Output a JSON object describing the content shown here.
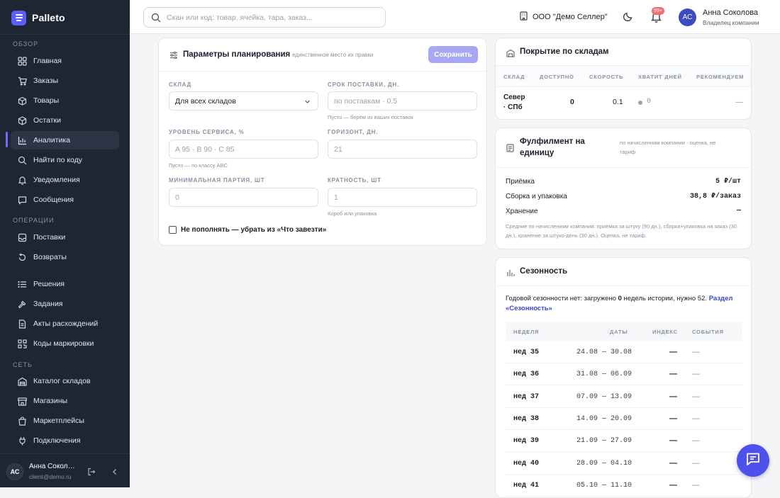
{
  "app": {
    "name": "Palleto"
  },
  "sidebar": {
    "sections": [
      {
        "label": "ОБЗОР"
      },
      {
        "label": "ОПЕРАЦИИ"
      },
      {
        "label": "СЕТЬ"
      }
    ],
    "items": [
      {
        "label": "Главная",
        "icon": "grid-icon"
      },
      {
        "label": "Заказы",
        "icon": "cart-icon"
      },
      {
        "label": "Товары",
        "icon": "box-icon"
      },
      {
        "label": "Остатки",
        "icon": "cube-icon"
      },
      {
        "label": "Аналитика",
        "icon": "chart-icon"
      },
      {
        "label": "Найти по коду",
        "icon": "search-icon"
      },
      {
        "label": "Уведомления",
        "icon": "bell-icon"
      },
      {
        "label": "Сообщения",
        "icon": "message-icon"
      },
      {
        "label": "Поставки",
        "icon": "inbox-icon"
      },
      {
        "label": "Возвраты",
        "icon": "return-icon"
      },
      {
        "label": "Решения",
        "icon": "list-icon"
      },
      {
        "label": "Задания",
        "icon": "hammer-icon"
      },
      {
        "label": "Акты расхождений",
        "icon": "document-icon"
      },
      {
        "label": "Коды маркировки",
        "icon": "qr-icon"
      },
      {
        "label": "Каталог складов",
        "icon": "warehouse-icon"
      },
      {
        "label": "Магазины",
        "icon": "store-icon"
      },
      {
        "label": "Маркетплейсы",
        "icon": "bag-icon"
      },
      {
        "label": "Подключения",
        "icon": "plug-icon"
      }
    ],
    "active_item": "Аналитика",
    "user": {
      "initials": "АС",
      "name": "Анна Соколова",
      "email": "client@demo.ru"
    }
  },
  "topbar": {
    "search_placeholder": "Скан или код: товар, ячейка, тара, заказ...",
    "org_name": "ООО \"Демо Селлер\"",
    "notifications_badge": "99+",
    "user_initials": "АС",
    "user_name": "Анна Соколова",
    "user_role": "Владелец компании"
  },
  "planning": {
    "title": "Параметры планирования",
    "subtitle": "единственное место их правки",
    "save_label": "Сохранить",
    "fields": {
      "warehouse": {
        "label": "СКЛАД",
        "value": "Для всех складов"
      },
      "lead_time": {
        "label": "СРОК ПОСТАВКИ, ДН.",
        "placeholder": "по поставкам · 0.5",
        "hint": "Пусто — берём из ваших поставок"
      },
      "service_level": {
        "label": "УРОВЕНЬ СЕРВИСА, %",
        "placeholder": "A 95 · B 90 · C 85",
        "hint": "Пусто — по классу ABC"
      },
      "horizon": {
        "label": "ГОРИЗОНТ, ДН.",
        "placeholder": "21"
      },
      "min_batch": {
        "label": "МИНИМАЛЬНАЯ ПАРТИЯ, ШТ",
        "placeholder": "0"
      },
      "multiplicity": {
        "label": "КРАТНОСТЬ, ШТ",
        "placeholder": "1",
        "hint": "Короб или упаковка"
      }
    },
    "checkbox_label": "Не пополнять — убрать из «Что завезти»"
  },
  "coverage": {
    "title": "Покрытие по складам",
    "columns": [
      "СКЛАД",
      "ДОСТУПНО",
      "СКОРОСТЬ",
      "ХВАТИТ ДНЕЙ",
      "РЕКОМЕНДУЕМ"
    ],
    "rows": [
      {
        "warehouse_line1": "Север",
        "warehouse_line2": "· СПб",
        "available": "0",
        "speed": "0.1",
        "days": "0",
        "recommend": "—"
      }
    ]
  },
  "fulfillment": {
    "title_line1": "Фулфилмент на",
    "title_line2": "единицу",
    "note_line1": "по начислениям компании · оценка, не",
    "note_line2": "тариф",
    "rows": [
      {
        "label": "Приёмка",
        "value": "5 ₽/шт"
      },
      {
        "label": "Сборка и упаковка",
        "value": "38,8 ₽/заказ"
      },
      {
        "label": "Хранение",
        "value": "—"
      }
    ],
    "footnote": "Средние по начислениям компании: приёмка за штуку (90 дн.), сборка+упаковка на заказ (30 дн.), хранение за штуко-день (30 дн.). Оценка, не тариф."
  },
  "seasonality": {
    "title": "Сезонность",
    "text_before": "Годовой сезонности нет: загружено",
    "weeks_loaded": "0",
    "text_middle": "недель истории, нужно 52.",
    "link": "Раздел «Сезонность»",
    "columns": [
      "НЕДЕЛЯ",
      "ДАТЫ",
      "ИНДЕКС",
      "СОБЫТИЯ"
    ],
    "rows": [
      {
        "week": "нед 35",
        "dates": "24.08 — 30.08",
        "index": "—",
        "events": "—"
      },
      {
        "week": "нед 36",
        "dates": "31.08 — 06.09",
        "index": "—",
        "events": "—"
      },
      {
        "week": "нед 37",
        "dates": "07.09 — 13.09",
        "index": "—",
        "events": "—"
      },
      {
        "week": "нед 38",
        "dates": "14.09 — 20.09",
        "index": "—",
        "events": "—"
      },
      {
        "week": "нед 39",
        "dates": "21.09 — 27.09",
        "index": "—",
        "events": "—"
      },
      {
        "week": "нед 40",
        "dates": "28.09 — 04.10",
        "index": "—",
        "events": "—"
      },
      {
        "week": "нед 41",
        "dates": "05.10 — 11.10",
        "index": "—",
        "events": "—"
      }
    ]
  },
  "colors": {
    "accent": "#4f51ec",
    "sidebar_bg": "#1e2533",
    "link": "#3646d6"
  }
}
